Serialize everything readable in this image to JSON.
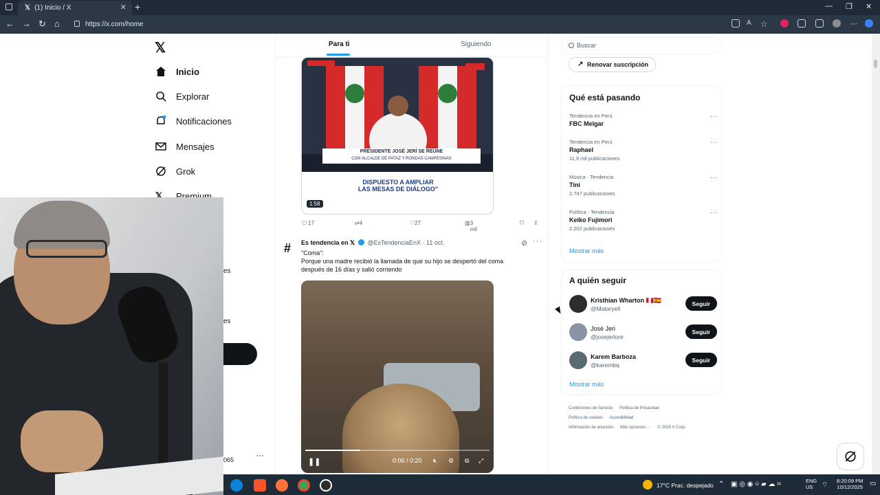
{
  "browser": {
    "tab_title": "(1) Inicio / X",
    "url": "https://x.com/home"
  },
  "nav": {
    "items": [
      {
        "label": "Inicio"
      },
      {
        "label": "Explorar"
      },
      {
        "label": "Notificaciones"
      },
      {
        "label": "Mensajes"
      },
      {
        "label": "Grok"
      },
      {
        "label": "Premium"
      }
    ],
    "partial_1": "es",
    "partial_2": "es",
    "partial_3": "065"
  },
  "feed": {
    "tab_foryou": "Para ti",
    "tab_following": "Siguiendo",
    "post1": {
      "banner_line1": "PRESIDENTE JOSÉ JERÍ SE REÚNE",
      "banner_line2": "CON ALCALDE DE PATAZ Y RONDAS CAMPESINAS",
      "caption_line1": "DISPUESTO A AMPLIAR",
      "caption_line2": "LAS MESAS DE DIÁLOGO\"",
      "duration": "1:58",
      "replies": "17",
      "reposts": "4",
      "likes": "27",
      "views": "3 mil"
    },
    "post2": {
      "author": "Es tendencia en 𝕏",
      "handle": "@EsTendenciaEnX",
      "date": "· 11 oct.",
      "text_line1": "\"Coma\":",
      "text_line2": "Porque una madre recibió la llamada de que su hijo se despertó del coma",
      "text_line3": "después de 16 días y salió corriendo",
      "video_time": "0:06 / 0:20",
      "progress": 0.3
    }
  },
  "right": {
    "search_placeholder": "Buscar",
    "renew_label": "Renovar suscripción",
    "trends_title": "Qué está pasando",
    "trends": [
      {
        "context": "Tendencia en Perú",
        "name": "FBC Melgar",
        "count": ""
      },
      {
        "context": "Tendencia en Perú",
        "name": "Raphael",
        "count": "11,9 mil publicaciones"
      },
      {
        "context": "Música · Tendencia",
        "name": "Tini",
        "count": "2.747 publicaciones"
      },
      {
        "context": "Política · Tendencia",
        "name": "Keiko Fujimori",
        "count": "2.202 publicaciones"
      }
    ],
    "show_more": "Mostrar más",
    "follow_title": "A quién seguir",
    "follow": [
      {
        "name": "Kristhian Wharton 🇵🇪🇪🇸",
        "handle": "@Mataryell",
        "button": "Seguir"
      },
      {
        "name": "José Jeri",
        "handle": "@josejerlore",
        "button": "Seguir"
      },
      {
        "name": "Karem Barboza",
        "handle": "@karembq",
        "button": "Seguir"
      }
    ],
    "footer_links": [
      "Condiciones de Servicio",
      "Política de Privacidad",
      "Política de cookies",
      "Accesibilidad",
      "Información de anuncios",
      "Más opciones ···",
      "© 2025 X Corp."
    ]
  },
  "taskbar": {
    "weather": "17°C  Prac. despejado",
    "lang_line1": "ENG",
    "lang_line2": "US",
    "time": "8:20:09 PM",
    "date": "10/12/2025"
  }
}
